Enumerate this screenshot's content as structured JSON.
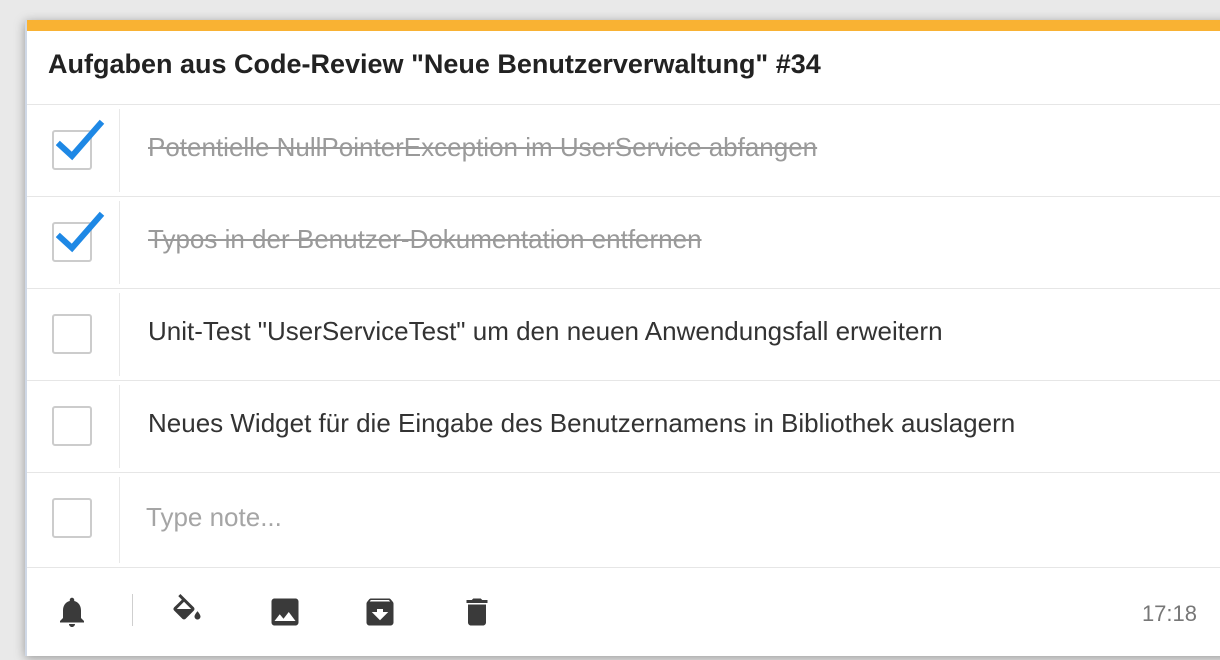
{
  "note": {
    "accent_color": "#f9b233",
    "title": "Aufgaben aus Code-Review \"Neue Benutzerverwaltung\" #34",
    "items": [
      {
        "text": "Potentielle NullPointerException im UserService abfangen",
        "checked": true
      },
      {
        "text": "Typos in der Benutzer-Dokumentation entfernen",
        "checked": true
      },
      {
        "text": "Unit-Test \"UserServiceTest\" um den neuen Anwendungsfall erweitern",
        "checked": false
      },
      {
        "text": "Neues Widget für die Eingabe des Benutzernamens in Bibliothek auslagern",
        "checked": false
      }
    ],
    "new_item": {
      "placeholder": "Type note...",
      "value": ""
    },
    "check_color": "#1e88e5"
  },
  "toolbar": {
    "icons": [
      "bell-icon",
      "paint-bucket-icon",
      "image-icon",
      "archive-icon",
      "trash-icon"
    ],
    "time": "17:18"
  }
}
